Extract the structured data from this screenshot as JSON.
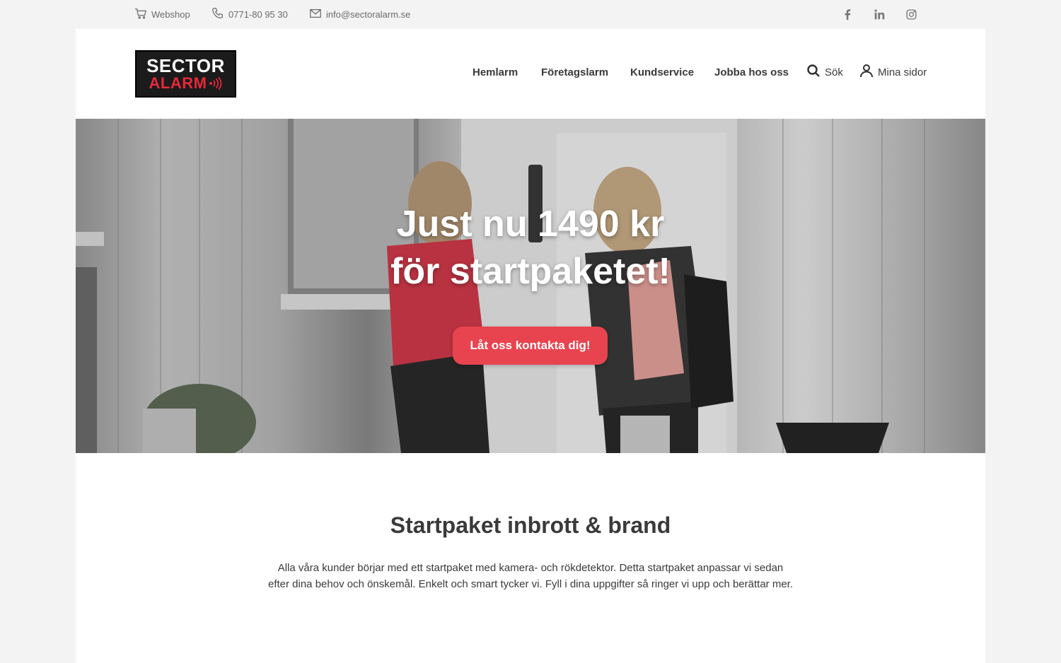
{
  "topbar": {
    "webshop": "Webshop",
    "phone": "0771-80 95 30",
    "email": "info@sectoralarm.se",
    "social": [
      "facebook-icon",
      "linkedin-icon",
      "instagram-icon"
    ]
  },
  "logo": {
    "line1": "SECTOR",
    "line2": "ALARM"
  },
  "nav": {
    "items": [
      "Hemlarm",
      "Företagslarm",
      "Kundservice",
      "Jobba hos oss"
    ],
    "search": "Sök",
    "account": "Mina sidor"
  },
  "hero": {
    "title_line1": "Just nu 1490 kr",
    "title_line2": "för startpaketet!",
    "cta": "Låt oss kontakta dig!"
  },
  "section": {
    "title": "Startpaket inbrott & brand",
    "text_line1": "Alla våra kunder börjar med ett startpaket med kamera- och rökdetektor. Detta startpaket anpassar vi sedan",
    "text_line2": "efter dina behov och önskemål. Enkelt och smart tycker vi. Fyll i dina uppgifter så ringer vi upp och berättar mer."
  },
  "colors": {
    "accent": "#e8444f",
    "logo_red": "#e8283a",
    "text": "#3a3a3a"
  }
}
